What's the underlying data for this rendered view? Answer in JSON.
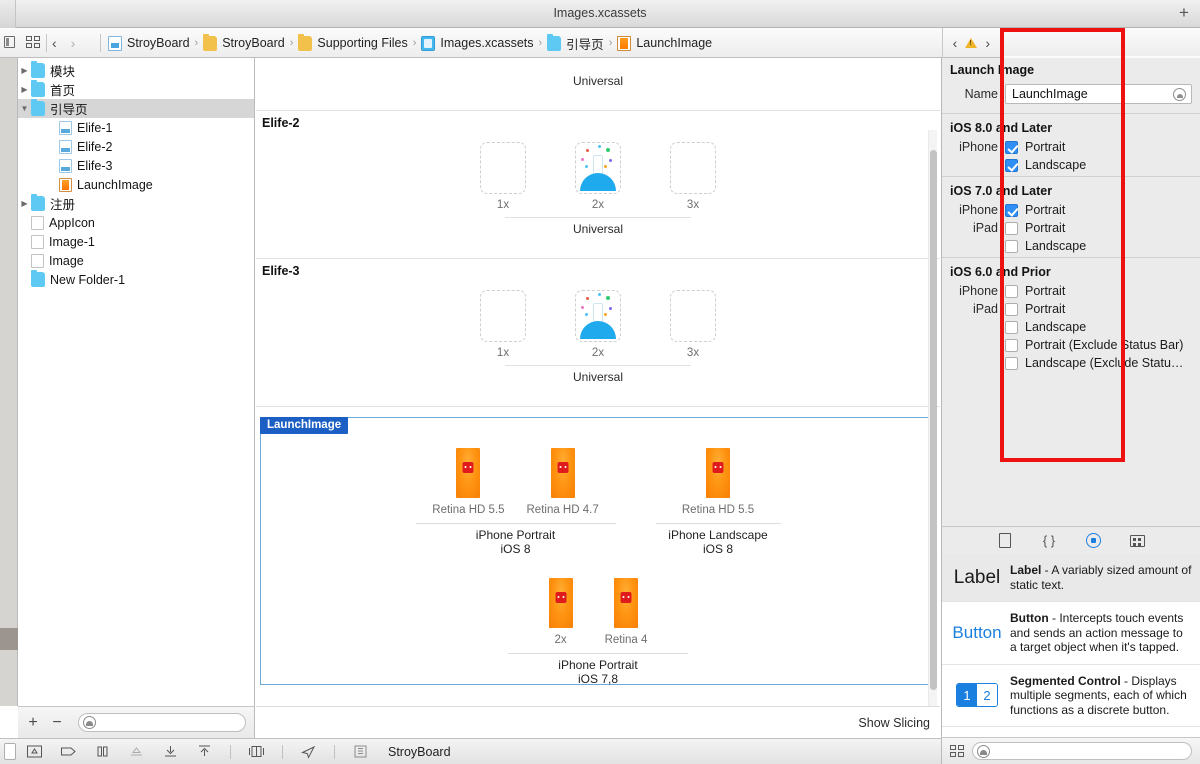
{
  "window": {
    "title": "Images.xcassets",
    "add_label": "+"
  },
  "jumpbar": {
    "back": "‹",
    "forward": "›",
    "crumbs": [
      {
        "label": "StroyBoard",
        "icon": "project-doc-icon"
      },
      {
        "label": "StroyBoard",
        "icon": "folder-icon"
      },
      {
        "label": "Supporting Files",
        "icon": "folder-icon"
      },
      {
        "label": "Images.xcassets",
        "icon": "xcassets-icon"
      },
      {
        "label": "引导页",
        "icon": "folder-blue-icon"
      },
      {
        "label": "LaunchImage",
        "icon": "launchimage-icon"
      }
    ],
    "sep": "›",
    "issue_prev": "‹",
    "issue_next": "›"
  },
  "inspector_tabs": [
    {
      "name": "file-inspector",
      "icon": "document-icon"
    },
    {
      "name": "quick-help-inspector",
      "icon": "question-mark-icon"
    },
    {
      "name": "attributes-inspector",
      "icon": "diamond-arrow-icon"
    }
  ],
  "navigator": {
    "items": [
      {
        "label": "模块",
        "icon": "folder-blue-icon",
        "disclosure": "closed",
        "indent": 0,
        "selected": false
      },
      {
        "label": "首页",
        "icon": "folder-blue-icon",
        "disclosure": "closed",
        "indent": 0,
        "selected": false
      },
      {
        "label": "引导页",
        "icon": "folder-blue-icon",
        "disclosure": "open",
        "indent": 0,
        "selected": true
      },
      {
        "label": "Elife-1",
        "icon": "imageset-icon",
        "disclosure": "none",
        "indent": 1,
        "selected": false
      },
      {
        "label": "Elife-2",
        "icon": "imageset-icon",
        "disclosure": "none",
        "indent": 1,
        "selected": false
      },
      {
        "label": "Elife-3",
        "icon": "imageset-icon",
        "disclosure": "none",
        "indent": 1,
        "selected": false
      },
      {
        "label": "LaunchImage",
        "icon": "launchimage-icon",
        "disclosure": "none",
        "indent": 1,
        "selected": false
      },
      {
        "label": "注册",
        "icon": "folder-blue-icon",
        "disclosure": "closed",
        "indent": 0,
        "selected": false
      },
      {
        "label": "AppIcon",
        "icon": "empty-set-icon",
        "disclosure": "none",
        "indent": 0,
        "selected": false
      },
      {
        "label": "Image-1",
        "icon": "empty-set-icon",
        "disclosure": "none",
        "indent": 0,
        "selected": false
      },
      {
        "label": "Image",
        "icon": "empty-set-icon",
        "disclosure": "none",
        "indent": 0,
        "selected": false
      },
      {
        "label": "New Folder-1",
        "icon": "folder-blue-icon",
        "disclosure": "none",
        "indent": 0,
        "selected": false
      }
    ],
    "footer": {
      "add": "+",
      "remove": "−",
      "filter_placeholder": ""
    }
  },
  "editor": {
    "top_group_footer": "Universal",
    "groups": [
      {
        "title": "Elife-2",
        "slots": [
          {
            "scale": "1x",
            "filled": false
          },
          {
            "scale": "2x",
            "filled": true
          },
          {
            "scale": "3x",
            "filled": false
          }
        ],
        "footer": "Universal"
      },
      {
        "title": "Elife-3",
        "slots": [
          {
            "scale": "1x",
            "filled": false
          },
          {
            "scale": "2x",
            "filled": true
          },
          {
            "scale": "3x",
            "filled": false
          }
        ],
        "footer": "Universal"
      }
    ],
    "launch_image": {
      "badge": "LaunchImage",
      "row1": [
        {
          "captions": [
            "Retina HD 5.5",
            "Retina HD 4.7"
          ],
          "subtitle_line1": "iPhone Portrait",
          "subtitle_line2": "iOS 8"
        },
        {
          "captions": [
            "Retina HD 5.5"
          ],
          "subtitle_line1": "iPhone Landscape",
          "subtitle_line2": "iOS 8"
        }
      ],
      "row2": [
        {
          "captions": [
            "2x",
            "Retina 4"
          ],
          "subtitle_line1": "iPhone Portrait",
          "subtitle_line2": "iOS 7,8"
        }
      ]
    },
    "show_slicing": "Show Slicing"
  },
  "attributes": {
    "title": "Launch Image",
    "name_label": "Name",
    "name_value": "LaunchImage",
    "sections": [
      {
        "heading": "iOS 8.0 and Later",
        "rows": [
          {
            "device": "iPhone",
            "option": "Portrait",
            "checked": true
          },
          {
            "device": "",
            "option": "Landscape",
            "checked": true
          }
        ]
      },
      {
        "heading": "iOS 7.0 and Later",
        "rows": [
          {
            "device": "iPhone",
            "option": "Portrait",
            "checked": true
          },
          {
            "device": "iPad",
            "option": "Portrait",
            "checked": false
          },
          {
            "device": "",
            "option": "Landscape",
            "checked": false
          }
        ]
      },
      {
        "heading": "iOS 6.0 and Prior",
        "rows": [
          {
            "device": "iPhone",
            "option": "Portrait",
            "checked": false
          },
          {
            "device": "iPad",
            "option": "Portrait",
            "checked": false
          },
          {
            "device": "",
            "option": "Landscape",
            "checked": false
          },
          {
            "device": "",
            "option": "Portrait (Exclude Status Bar)",
            "checked": false
          },
          {
            "device": "",
            "option": "Landscape (Exclude Statu…",
            "checked": false
          }
        ]
      }
    ]
  },
  "library": {
    "tabs": [
      {
        "name": "file-template-library",
        "icon": "document-icon",
        "active": false
      },
      {
        "name": "code-snippet-library",
        "icon": "braces-icon",
        "active": false
      },
      {
        "name": "object-library",
        "icon": "circle-target-icon",
        "active": true
      },
      {
        "name": "media-library",
        "icon": "media-icon",
        "active": false
      }
    ],
    "items": [
      {
        "preview": "Label",
        "preview_type": "label",
        "name": "Label",
        "desc": " - A variably sized amount of static text.",
        "selected": true
      },
      {
        "preview": "Button",
        "preview_type": "button",
        "name": "Button",
        "desc": " - Intercepts touch events and sends an action message to a target object when it's tapped.",
        "selected": false
      },
      {
        "preview": "1 2",
        "preview_type": "segmented",
        "seg1": "1",
        "seg2": "2",
        "name": "Segmented Control",
        "desc": " - Displays multiple segments, each of which functions as a discrete button.",
        "selected": false
      }
    ],
    "filter_placeholder": ""
  },
  "bottombar": {
    "scheme_label": "StroyBoard",
    "icons": [
      "align-icon",
      "tag-icon",
      "pause-bars-icon",
      "unembed-icon",
      "align-bottom-icon",
      "align-top-icon",
      "resolve-autolayout-icon",
      "navigate-icon"
    ]
  },
  "colors": {
    "accent_blue": "#1b7fe0",
    "selection_blue": "#1c5fc4",
    "checkbox_blue": "#2f8ff5",
    "annotation_red": "#ee1111",
    "launch_orange": "#ff9412",
    "folder_yellow": "#f2c14b",
    "folder_blue": "#5ec9f2"
  }
}
